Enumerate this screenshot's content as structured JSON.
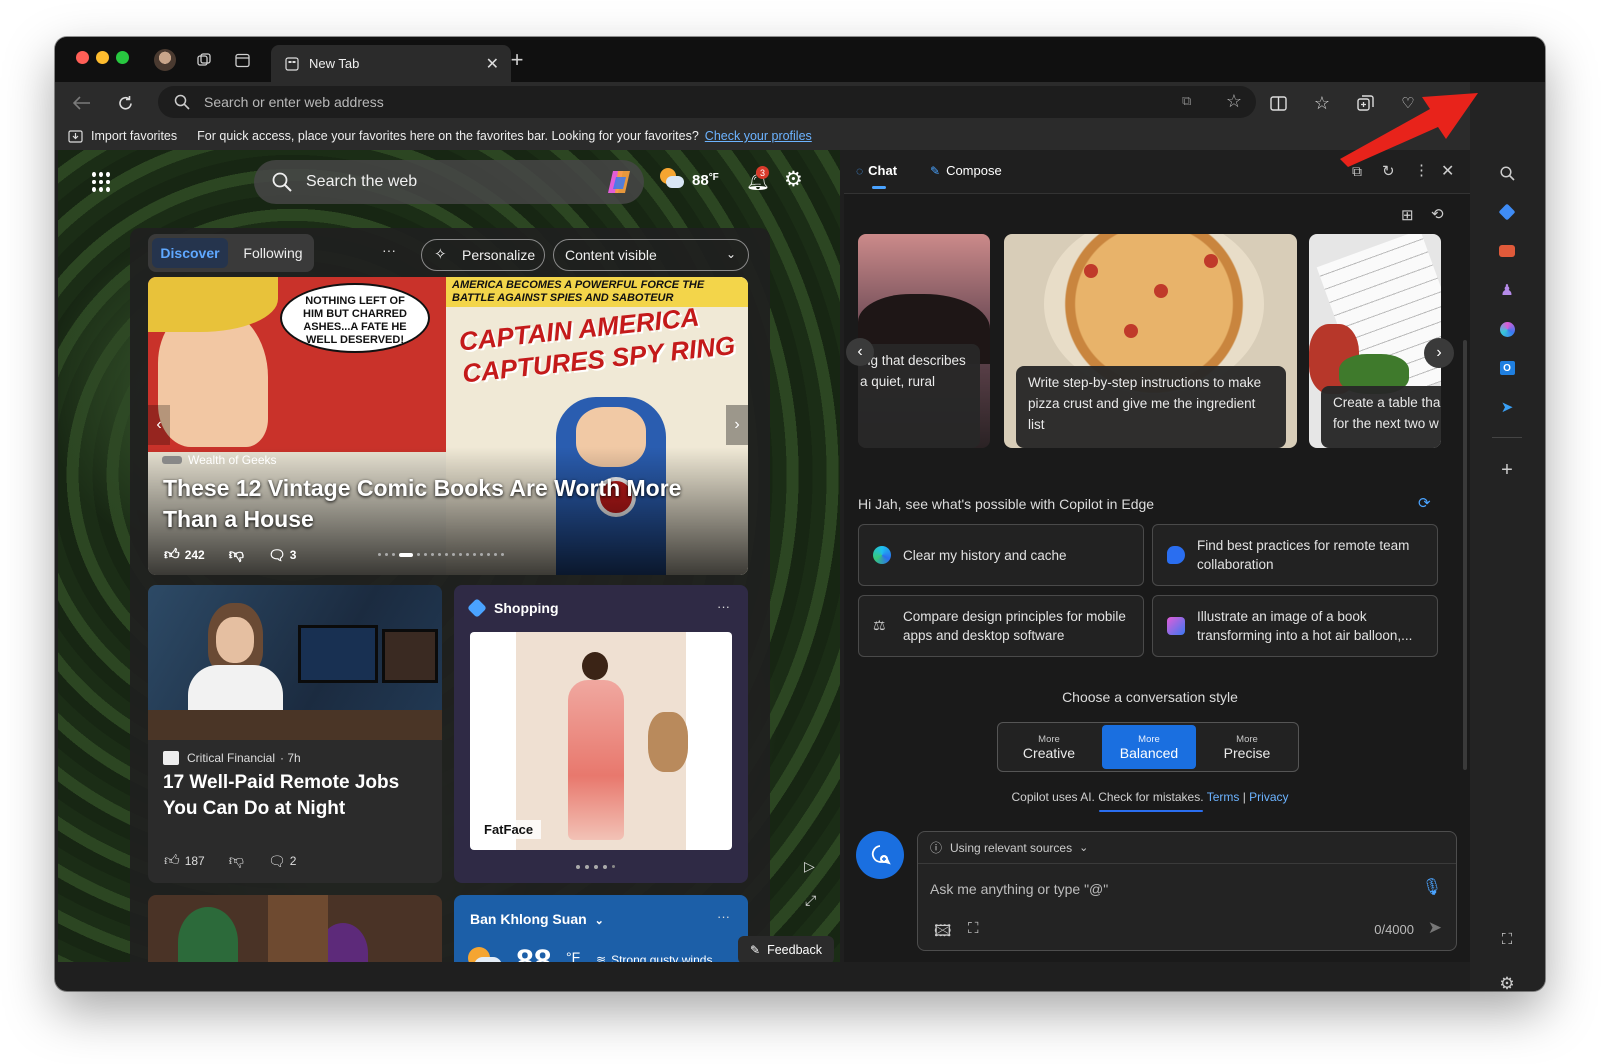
{
  "browser": {
    "tab_title": "New Tab",
    "address_placeholder": "Search or enter web address",
    "favbar": {
      "import_label": "Import favorites",
      "message": "For quick access, place your favorites here on the favorites bar. Looking for your favorites?",
      "link": "Check your profiles"
    }
  },
  "ntp": {
    "search_placeholder": "Search the web",
    "weather_temp": "88",
    "weather_unit": "°F",
    "notification_count": "3",
    "tabs": [
      "Discover",
      "Following"
    ],
    "more": "···",
    "personalize": "Personalize",
    "content_visible": "Content visible",
    "hero": {
      "source": "Wealth of Geeks",
      "title": "These 12 Vintage Comic Books Are Worth More Than a House",
      "likes": "242",
      "comments": "3",
      "comic_left_bubble": "NOTHING LEFT OF HIM BUT CHARRED ASHES...A FATE HE WELL DESERVED!",
      "comic_top_banner": "AMERICA BECOMES A POWERFUL FORCE THE BATTLE AGAINST SPIES AND SABOTEUR",
      "comic_title": "CAPTAIN AMERICA CAPTURES SPY RING"
    },
    "card2": {
      "source": "Critical Financial",
      "age": "· 7h",
      "title": "17 Well-Paid Remote Jobs You Can Do at Night",
      "likes": "187",
      "comments": "2"
    },
    "shopping": {
      "label": "Shopping",
      "brand": "FatFace",
      "more": "···"
    },
    "weather_card": {
      "location": "Ban Khlong Suan",
      "temp": "88",
      "unit": "°F",
      "condition": "Strong gusty winds",
      "more": "···"
    },
    "feedback": "Feedback"
  },
  "copilot": {
    "tabs": [
      "Chat",
      "Compose"
    ],
    "prompt_cards": [
      "ing that describes a quiet, rural",
      "Write step-by-step instructions to make pizza crust and give me the ingredient list",
      "Create a table tha for the next two w"
    ],
    "greeting": "Hi Jah, see what's possible with Copilot in Edge",
    "suggestions": [
      "Clear my history and cache",
      "Find best practices for remote team collaboration",
      "Compare design principles for mobile apps and desktop software",
      "Illustrate an image of a book transforming into a hot air balloon,..."
    ],
    "style_heading": "Choose a conversation style",
    "styles": [
      {
        "top": "More",
        "label": "Creative"
      },
      {
        "top": "More",
        "label": "Balanced"
      },
      {
        "top": "More",
        "label": "Precise"
      }
    ],
    "disclaimer": "Copilot uses AI. Check for mistakes.",
    "terms": "Terms",
    "sep": "|",
    "privacy": "Privacy",
    "sources": "Using relevant sources",
    "input_placeholder": "Ask me anything or type \"@\"",
    "char_count": "0/4000"
  },
  "colors": {
    "accent_blue": "#1a6fe0",
    "link_blue": "#6cb3ff",
    "arrow_red": "#e8231b"
  }
}
